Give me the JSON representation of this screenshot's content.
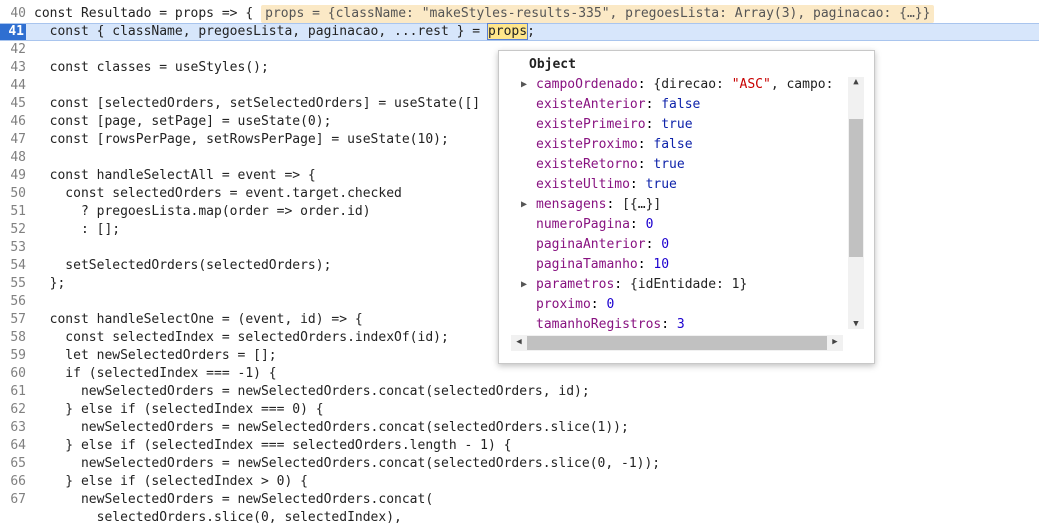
{
  "editor": {
    "lines": [
      {
        "num": "40",
        "code": "const Resultado = props => {"
      },
      {
        "num": "41",
        "code": "  const { className, pregoesLista, paginacao, ...rest } = "
      },
      {
        "num": "42",
        "code": ""
      },
      {
        "num": "43",
        "code": "  const classes = useStyles();"
      },
      {
        "num": "44",
        "code": ""
      },
      {
        "num": "45",
        "code": "  const [selectedOrders, setSelectedOrders] = useState([]"
      },
      {
        "num": "46",
        "code": "  const [page, setPage] = useState(0);"
      },
      {
        "num": "47",
        "code": "  const [rowsPerPage, setRowsPerPage] = useState(10);"
      },
      {
        "num": "48",
        "code": ""
      },
      {
        "num": "49",
        "code": "  const handleSelectAll = event => {"
      },
      {
        "num": "50",
        "code": "    const selectedOrders = event.target.checked"
      },
      {
        "num": "51",
        "code": "      ? pregoesLista.map(order => order.id)"
      },
      {
        "num": "52",
        "code": "      : [];"
      },
      {
        "num": "53",
        "code": ""
      },
      {
        "num": "54",
        "code": "    setSelectedOrders(selectedOrders);"
      },
      {
        "num": "55",
        "code": "  };"
      },
      {
        "num": "56",
        "code": ""
      },
      {
        "num": "57",
        "code": "  const handleSelectOne = (event, id) => {"
      },
      {
        "num": "58",
        "code": "    const selectedIndex = selectedOrders.indexOf(id);"
      },
      {
        "num": "59",
        "code": "    let newSelectedOrders = [];"
      },
      {
        "num": "60",
        "code": "    if (selectedIndex === -1) {"
      },
      {
        "num": "61",
        "code": "      newSelectedOrders = newSelectedOrders.concat(selectedOrders, id);"
      },
      {
        "num": "62",
        "code": "    } else if (selectedIndex === 0) {"
      },
      {
        "num": "63",
        "code": "      newSelectedOrders = newSelectedOrders.concat(selectedOrders.slice(1));"
      },
      {
        "num": "64",
        "code": "    } else if (selectedIndex === selectedOrders.length - 1) {"
      },
      {
        "num": "65",
        "code": "      newSelectedOrders = newSelectedOrders.concat(selectedOrders.slice(0, -1));"
      },
      {
        "num": "66",
        "code": "    } else if (selectedIndex > 0) {"
      },
      {
        "num": "67",
        "code": "      newSelectedOrders = newSelectedOrders.concat("
      },
      {
        "num": "",
        "code": "        selectedOrders.slice(0, selectedIndex),"
      }
    ],
    "inline_hint": "props = {className: \"makeStyles-results-335\", pregoesLista: Array(3), paginacao: {…}}",
    "highlighted_token": "props",
    "highlighted_suffix": ";"
  },
  "popover": {
    "title": "Object",
    "properties": [
      {
        "expandable": true,
        "key": "campoOrdenado",
        "value": "{direcao: \"ASC\", campo:",
        "type": "obj"
      },
      {
        "expandable": false,
        "key": "existeAnterior",
        "value": "false",
        "type": "bool"
      },
      {
        "expandable": false,
        "key": "existePrimeiro",
        "value": "true",
        "type": "bool"
      },
      {
        "expandable": false,
        "key": "existeProximo",
        "value": "false",
        "type": "bool"
      },
      {
        "expandable": false,
        "key": "existeRetorno",
        "value": "true",
        "type": "bool"
      },
      {
        "expandable": false,
        "key": "existeUltimo",
        "value": "true",
        "type": "bool"
      },
      {
        "expandable": true,
        "key": "mensagens",
        "value": "[{…}]",
        "type": "obj"
      },
      {
        "expandable": false,
        "key": "numeroPagina",
        "value": "0",
        "type": "num"
      },
      {
        "expandable": false,
        "key": "paginaAnterior",
        "value": "0",
        "type": "num"
      },
      {
        "expandable": false,
        "key": "paginaTamanho",
        "value": "10",
        "type": "num"
      },
      {
        "expandable": true,
        "key": "parametros",
        "value": "{idEntidade: 1}",
        "type": "obj"
      },
      {
        "expandable": false,
        "key": "proximo",
        "value": "0",
        "type": "num"
      },
      {
        "expandable": false,
        "key": "tamanhoRegistros",
        "value": "3",
        "type": "num"
      }
    ]
  }
}
